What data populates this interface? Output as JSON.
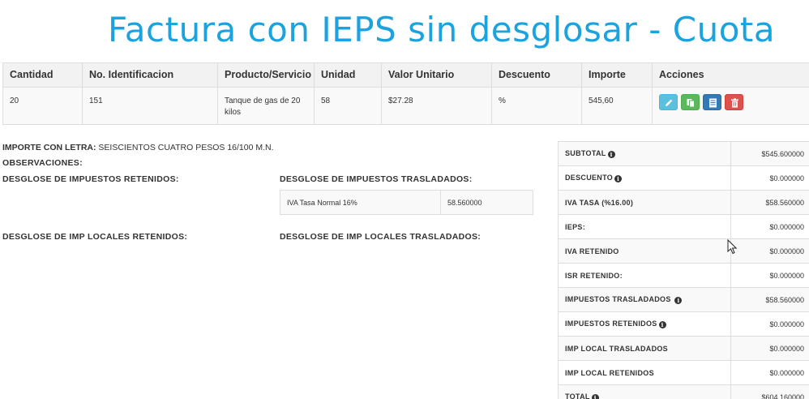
{
  "banner": {
    "title": "Factura con IEPS sin desglosar - Cuota"
  },
  "items_table": {
    "headers": [
      "Cantidad",
      "No. Identificacion",
      "Producto/Servicio",
      "Unidad",
      "Valor Unitario",
      "Descuento",
      "Importe",
      "Acciones"
    ],
    "rows": [
      {
        "cantidad": "20",
        "no_identificacion": "151",
        "producto": "Tanque de gas de 20 kilos",
        "unidad": "58",
        "valor_unitario": "$27.28",
        "descuento": "%",
        "importe": "545,60",
        "actions": [
          "pencil-icon",
          "copy-icon",
          "list-icon",
          "trash-icon"
        ]
      }
    ]
  },
  "info": {
    "importe_letra_label": "IMPORTE CON LETRA:",
    "importe_letra_value": "SEISCIENTOS CUATRO PESOS 16/100 M.N.",
    "observaciones_label": "OBSERVACIONES:",
    "desglose_retenidos": "DESGLOSE DE IMPUESTOS RETENIDOS:",
    "desglose_trasladados": "DESGLOSE DE IMPUESTOS TRASLADADOS:",
    "desglose_locales_retenidos": "DESGLOSE DE IMP LOCALES RETENIDOS:",
    "desglose_locales_trasladados": "DESGLOSE DE IMP LOCALES TRASLADADOS:"
  },
  "trasladados": [
    {
      "name": "IVA Tasa Normal 16%",
      "amount": "58.560000"
    }
  ],
  "totals": [
    {
      "label": "SUBTOTAL",
      "info": true,
      "value": "$545.600000"
    },
    {
      "label": "DESCUENTO",
      "info": true,
      "value": "$0.000000"
    },
    {
      "label": "IVA TASA (%16.00)",
      "info": false,
      "value": "$58.560000"
    },
    {
      "label": "IEPS:",
      "info": false,
      "value": "$0.000000"
    },
    {
      "label": "IVA RETENIDO",
      "info": false,
      "value": "$0.000000"
    },
    {
      "label": "ISR RETENIDO:",
      "info": false,
      "value": "$0.000000"
    },
    {
      "label": "IMPUESTOS TRASLADADOS",
      "info": true,
      "value": "$58.560000"
    },
    {
      "label": "IMPUESTOS RETENIDOS",
      "info": true,
      "value": "$0.000000"
    },
    {
      "label": "IMP LOCAL TRASLADADOS",
      "info": false,
      "value": "$0.000000"
    },
    {
      "label": "IMP LOCAL RETENIDOS",
      "info": false,
      "value": "$0.000000"
    },
    {
      "label": "TOTAL",
      "info": true,
      "value": "$604.160000"
    }
  ],
  "info_glyph": "i",
  "colors": {
    "banner": "#1aa3df",
    "edit_button": "#5bc0de",
    "copy_button": "#5cb85c",
    "list_button": "#337ab7",
    "delete_button": "#d9534f"
  }
}
